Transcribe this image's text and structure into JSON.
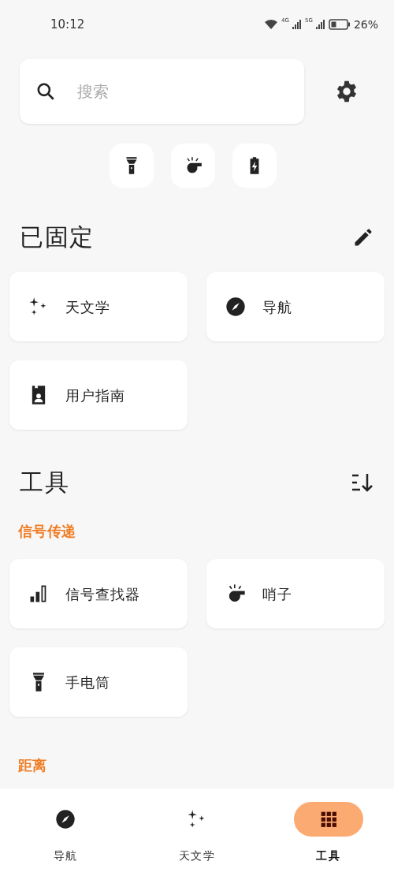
{
  "status_bar": {
    "time": "10:12",
    "network_1": "4G",
    "network_2": "5G",
    "battery": "26%"
  },
  "search": {
    "placeholder": "搜索"
  },
  "quick_actions": [
    {
      "kind": "flashlight"
    },
    {
      "kind": "whistle"
    },
    {
      "kind": "battery"
    }
  ],
  "pinned": {
    "title": "已固定",
    "items": [
      {
        "label": "天文学",
        "kind": "stars"
      },
      {
        "label": "导航",
        "kind": "compass"
      },
      {
        "label": "用户指南",
        "kind": "guide"
      }
    ]
  },
  "tools": {
    "title": "工具",
    "groups": [
      {
        "title": "信号传递",
        "items": [
          {
            "label": "信号查找器",
            "kind": "signal"
          },
          {
            "label": "哨子",
            "kind": "whistle"
          },
          {
            "label": "手电筒",
            "kind": "flashlight"
          }
        ]
      },
      {
        "title": "距离"
      }
    ]
  },
  "bottom_nav": [
    {
      "label": "导航",
      "kind": "compass",
      "selected": false
    },
    {
      "label": "天文学",
      "kind": "stars",
      "selected": false
    },
    {
      "label": "工具",
      "kind": "grid",
      "selected": true
    }
  ]
}
